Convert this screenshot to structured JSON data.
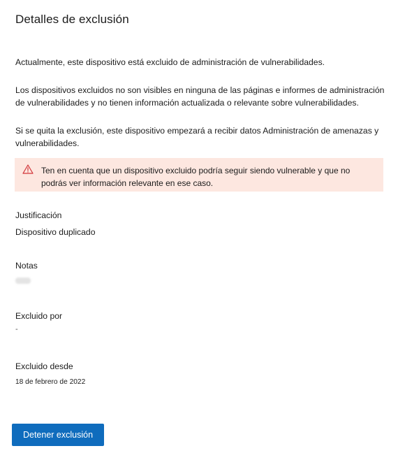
{
  "panel": {
    "title": "Detalles de exclusión"
  },
  "paragraphs": {
    "current_status": "Actualmente, este dispositivo está excluido de administración de vulnerabilidades.",
    "visibility": "Los dispositivos excluidos no son visibles en ninguna de las páginas e informes de administración de vulnerabilidades y no tienen información actualizada o relevante sobre vulnerabilidades.",
    "removal": "Si se quita la exclusión, este dispositivo empezará a recibir datos Administración de amenazas y vulnerabilidades."
  },
  "warning": {
    "icon": "warning-triangle-icon",
    "text": "Ten en cuenta que un dispositivo excluido podría seguir siendo vulnerable y que no podrás ver información relevante en ese caso.",
    "background_color": "#fde7e0",
    "icon_color": "#d13438"
  },
  "fields": {
    "justification": {
      "label": "Justificación",
      "value": "Dispositivo duplicado"
    },
    "notes": {
      "label": "Notas"
    },
    "excluded_by": {
      "label": "Excluido por",
      "value": "-"
    },
    "excluded_since": {
      "label": "Excluido desde",
      "value": "18 de febrero de 2022"
    }
  },
  "actions": {
    "stop_exclusion_label": "Detener exclusión",
    "button_color": "#0f6cbd"
  }
}
